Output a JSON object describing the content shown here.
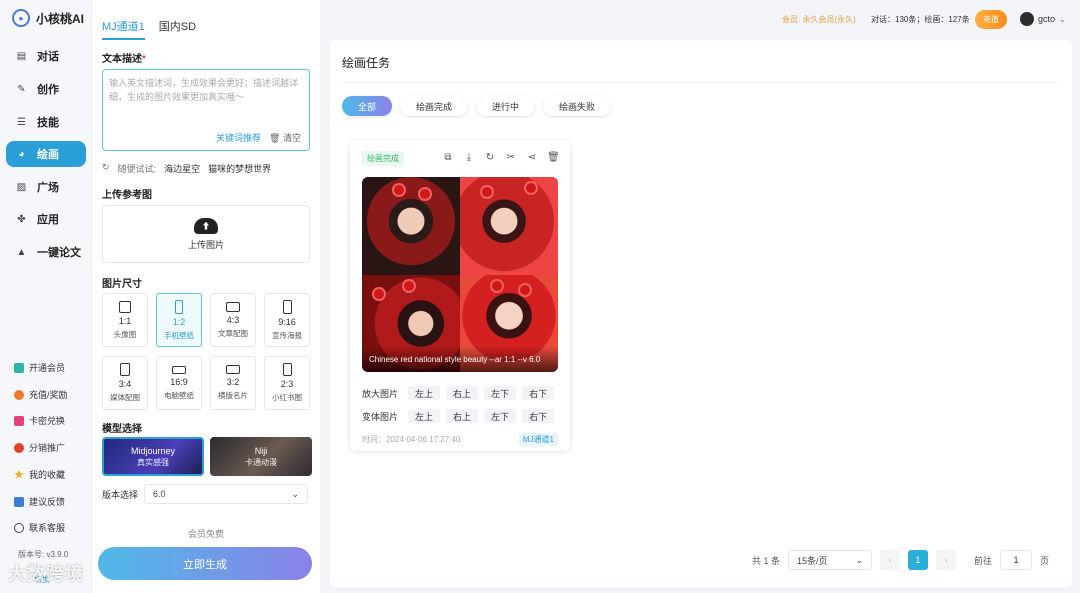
{
  "app": {
    "name": "小核桃AI"
  },
  "sidebar": {
    "items": [
      {
        "label": "对话",
        "icon": "chat-icon"
      },
      {
        "label": "创作",
        "icon": "pen-icon"
      },
      {
        "label": "技能",
        "icon": "list-icon"
      },
      {
        "label": "绘画",
        "icon": "palette-icon"
      },
      {
        "label": "广场",
        "icon": "image-icon"
      },
      {
        "label": "应用",
        "icon": "apps-icon"
      },
      {
        "label": "一键论文",
        "icon": "graduation-cap-icon"
      }
    ],
    "bottom": [
      {
        "label": "开通会员",
        "color": "#2fb3a5"
      },
      {
        "label": "充值/奖励",
        "color": "#f07a2a"
      },
      {
        "label": "卡密兑换",
        "color": "#e6407a"
      },
      {
        "label": "分销推广",
        "color": "#e8402a"
      },
      {
        "label": "我的收藏",
        "color": "#f0b020"
      },
      {
        "label": "建议反馈",
        "color": "#3a7ad8"
      },
      {
        "label": "联系客服",
        "color": "#444444"
      }
    ],
    "version": "版本号: v3.9.0",
    "switch_label": "切换"
  },
  "form": {
    "tabs": [
      "MJ通道1",
      "国内SD"
    ],
    "prompt_label": "文本描述",
    "prompt_placeholder": "输入英文描述词，生成效果会更好；描述词越详细，生成的图片效果更加真实哦～",
    "keyword_btn": "关键词推荐",
    "clear_btn": "清空",
    "try_label": "随便试试:",
    "try_items": [
      "海边星空",
      "猫咪的梦想世界"
    ],
    "upload_label": "上传参考图",
    "upload_btn": "上传图片",
    "size_label": "图片尺寸",
    "sizes": [
      {
        "ratio": "1:1",
        "cap": "头像图"
      },
      {
        "ratio": "1:2",
        "cap": "手机壁纸"
      },
      {
        "ratio": "4:3",
        "cap": "文章配图"
      },
      {
        "ratio": "9:16",
        "cap": "宣传海报"
      },
      {
        "ratio": "3:4",
        "cap": "媒体配图"
      },
      {
        "ratio": "16:9",
        "cap": "电脑壁纸"
      },
      {
        "ratio": "3:2",
        "cap": "横版名片"
      },
      {
        "ratio": "2:3",
        "cap": "小红书图"
      }
    ],
    "selected_size": "1:2",
    "model_label": "模型选择",
    "models": [
      {
        "name": "Midjourney",
        "sub": "真实感强"
      },
      {
        "name": "Niji",
        "sub": "卡通动漫"
      }
    ],
    "version_label": "版本选择",
    "version_value": "6.0",
    "free_text": "会员免费",
    "generate_btn": "立即生成"
  },
  "topbar": {
    "vip": "会员: 永久会员(永久)",
    "stats": "对话：130条；绘画：127条",
    "pay_btn": "充值",
    "username": "gcto"
  },
  "panel": {
    "title": "绘画任务",
    "filters": [
      "全部",
      "绘画完成",
      "进行中",
      "绘画失败"
    ],
    "card": {
      "status": "绘画完成",
      "caption": "Chinese red national style beauty --ar 1:1 --v 6.0",
      "upscale_label": "放大图片",
      "variation_label": "变体图片",
      "positions": [
        "左上",
        "右上",
        "左下",
        "右下"
      ],
      "time": "时间：2024-04-06 17:27:40",
      "channel": "MJ通道1"
    },
    "pager": {
      "total": "共 1 条",
      "per_page": "15条/页",
      "current": "1",
      "goto_label": "前往",
      "goto_value": "1",
      "page_suffix": "页"
    }
  },
  "watermark": "大数跨境"
}
